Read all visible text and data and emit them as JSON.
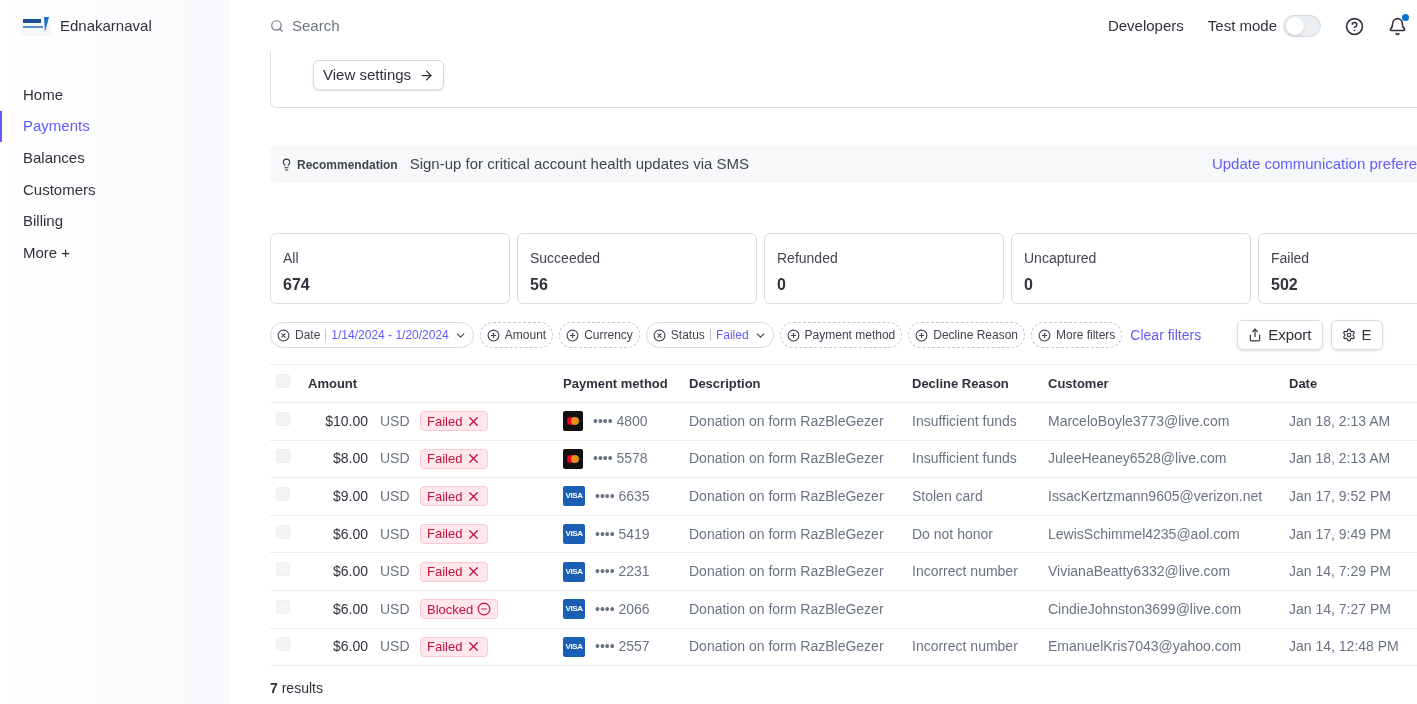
{
  "brand": {
    "name": "Ednakarnaval"
  },
  "sidebar": {
    "items": [
      {
        "label": "Home",
        "selected": false
      },
      {
        "label": "Payments",
        "selected": true
      },
      {
        "label": "Balances",
        "selected": false
      },
      {
        "label": "Customers",
        "selected": false
      },
      {
        "label": "Billing",
        "selected": false
      },
      {
        "label": "More +",
        "selected": false
      }
    ]
  },
  "topbar": {
    "search": {
      "placeholder": "Search"
    },
    "developers": "Developers",
    "test_mode": {
      "label": "Test mode",
      "on": false
    },
    "notifications": {
      "unread": true
    }
  },
  "settings_card": {
    "button": "View settings"
  },
  "recommendation": {
    "tag": "Recommendation",
    "text": "Sign-up for critical account health updates via SMS",
    "link": "Update communication prefere"
  },
  "status_cards": [
    {
      "label": "All",
      "count": "674"
    },
    {
      "label": "Succeeded",
      "count": "56"
    },
    {
      "label": "Refunded",
      "count": "0"
    },
    {
      "label": "Uncaptured",
      "count": "0"
    },
    {
      "label": "Failed",
      "count": "502"
    }
  ],
  "filters": [
    {
      "kind": "active",
      "label": "Date",
      "value": "1/14/2024 - 1/20/2024"
    },
    {
      "kind": "add",
      "label": "Amount"
    },
    {
      "kind": "add",
      "label": "Currency"
    },
    {
      "kind": "active",
      "label": "Status",
      "value": "Failed"
    },
    {
      "kind": "add",
      "label": "Payment method"
    },
    {
      "kind": "add",
      "label": "Decline Reason"
    },
    {
      "kind": "add",
      "label": "More filters"
    }
  ],
  "clear_filters": "Clear filters",
  "actions": [
    {
      "kind": "export",
      "label": "Export"
    },
    {
      "kind": "edit",
      "label": "E"
    }
  ],
  "table": {
    "columns": [
      "Amount",
      "Payment method",
      "Description",
      "Decline Reason",
      "Customer",
      "Date"
    ],
    "select_all": {
      "checked": false
    },
    "rows": [
      {
        "checked": false,
        "amount": "$10.00",
        "currency": "USD",
        "status": {
          "kind": "failed",
          "label": "Failed"
        },
        "card": {
          "kind": "mastercard"
        },
        "last4": "•••• 4800",
        "description": "Donation on form RazBleGezer",
        "decline_reason": "Insufficient funds",
        "customer": "MarceloBoyle3773@live.com",
        "date": "Jan 18, 2:13 AM"
      },
      {
        "checked": false,
        "amount": "$8.00",
        "currency": "USD",
        "status": {
          "kind": "failed",
          "label": "Failed"
        },
        "card": {
          "kind": "mastercard"
        },
        "last4": "•••• 5578",
        "description": "Donation on form RazBleGezer",
        "decline_reason": "Insufficient funds",
        "customer": "JuleeHeaney6528@live.com",
        "date": "Jan 18, 2:13 AM"
      },
      {
        "checked": false,
        "amount": "$9.00",
        "currency": "USD",
        "status": {
          "kind": "failed",
          "label": "Failed"
        },
        "card": {
          "kind": "visa",
          "text": "VISA"
        },
        "last4": "•••• 6635",
        "description": "Donation on form RazBleGezer",
        "decline_reason": "Stolen card",
        "customer": "IssacKertzmann9605@verizon.net",
        "date": "Jan 17, 9:52 PM"
      },
      {
        "checked": false,
        "amount": "$6.00",
        "currency": "USD",
        "status": {
          "kind": "failed",
          "label": "Failed"
        },
        "card": {
          "kind": "visa",
          "text": "VISA"
        },
        "last4": "•••• 5419",
        "description": "Donation on form RazBleGezer",
        "decline_reason": "Do not honor",
        "customer": "LewisSchimmel4235@aol.com",
        "date": "Jan 17, 9:49 PM"
      },
      {
        "checked": false,
        "amount": "$6.00",
        "currency": "USD",
        "status": {
          "kind": "failed",
          "label": "Failed"
        },
        "card": {
          "kind": "visa",
          "text": "VISA"
        },
        "last4": "•••• 2231",
        "description": "Donation on form RazBleGezer",
        "decline_reason": "Incorrect number",
        "customer": "VivianaBeatty6332@live.com",
        "date": "Jan 14, 7:29 PM"
      },
      {
        "checked": false,
        "amount": "$6.00",
        "currency": "USD",
        "status": {
          "kind": "blocked",
          "label": "Blocked"
        },
        "card": {
          "kind": "visa",
          "text": "VISA"
        },
        "last4": "•••• 2066",
        "description": "Donation on form RazBleGezer",
        "customer": "CindieJohnston3699@live.com",
        "date": "Jan 14, 7:27 PM"
      },
      {
        "checked": false,
        "amount": "$6.00",
        "currency": "USD",
        "status": {
          "kind": "failed",
          "label": "Failed"
        },
        "card": {
          "kind": "visa",
          "text": "VISA"
        },
        "last4": "•••• 2557",
        "description": "Donation on form RazBleGezer",
        "decline_reason": "Incorrect number",
        "customer": "EmanuelKris7043@yahoo.com",
        "date": "Jan 14, 12:48 PM"
      }
    ]
  },
  "results": "**7** results"
}
